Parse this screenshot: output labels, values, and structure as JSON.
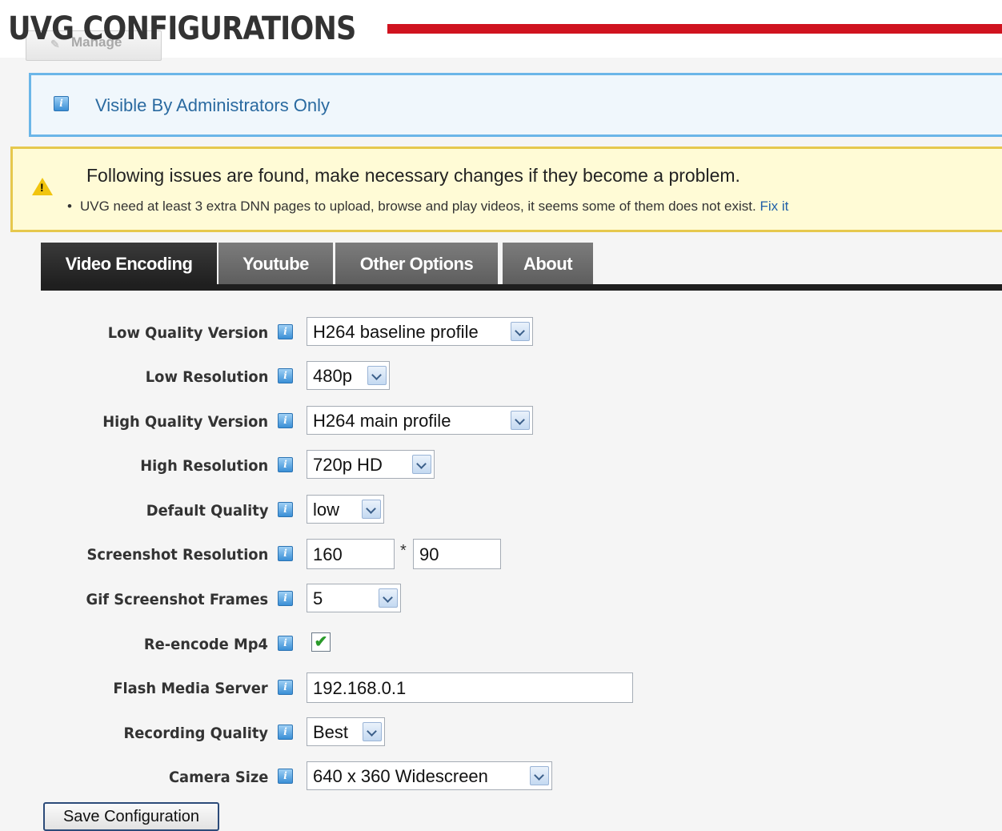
{
  "header": {
    "title": "UVG CONFIGURATIONS",
    "manage_label": "Manage"
  },
  "admin_notice": {
    "text": "Visible By Administrators Only"
  },
  "warning": {
    "title": "Following issues are found, make necessary changes if they become a problem.",
    "item_text": "UVG need at least 3 extra DNN pages to upload, browse and play videos, it seems some of them does not exist.",
    "fix_link": "Fix it"
  },
  "tabs": [
    {
      "label": "Video Encoding",
      "active": true
    },
    {
      "label": "Youtube",
      "active": false
    },
    {
      "label": "Other Options",
      "active": false
    },
    {
      "label": "About",
      "active": false
    }
  ],
  "form": {
    "low_quality_version": {
      "label": "Low Quality Version",
      "value": "H264 baseline profile"
    },
    "low_resolution": {
      "label": "Low Resolution",
      "value": "480p"
    },
    "high_quality_version": {
      "label": "High Quality Version",
      "value": "H264 main profile"
    },
    "high_resolution": {
      "label": "High Resolution",
      "value": "720p HD"
    },
    "default_quality": {
      "label": "Default Quality",
      "value": "low"
    },
    "screenshot_resolution": {
      "label": "Screenshot Resolution",
      "width": "160",
      "separator": "*",
      "height": "90"
    },
    "gif_screenshot_frames": {
      "label": "Gif Screenshot Frames",
      "value": "5"
    },
    "reencode_mp4": {
      "label": "Re-encode Mp4",
      "checked": true
    },
    "flash_media_server": {
      "label": "Flash Media Server",
      "value": "192.168.0.1"
    },
    "recording_quality": {
      "label": "Recording Quality",
      "value": "Best"
    },
    "camera_size": {
      "label": "Camera Size",
      "value": "640 x 360 Widescreen"
    }
  },
  "save_button": {
    "label": "Save Configuration"
  },
  "colors": {
    "title_rule": "#d0131f",
    "admin_border": "#6bb6e8",
    "warning_border": "#e6c84d",
    "tab_active": "#1e1e1e",
    "tab_inactive": "#666666"
  },
  "icons": {
    "info": "info-icon",
    "warning": "warning-icon",
    "dropdown": "chevron-down-icon",
    "check": "check-icon"
  }
}
